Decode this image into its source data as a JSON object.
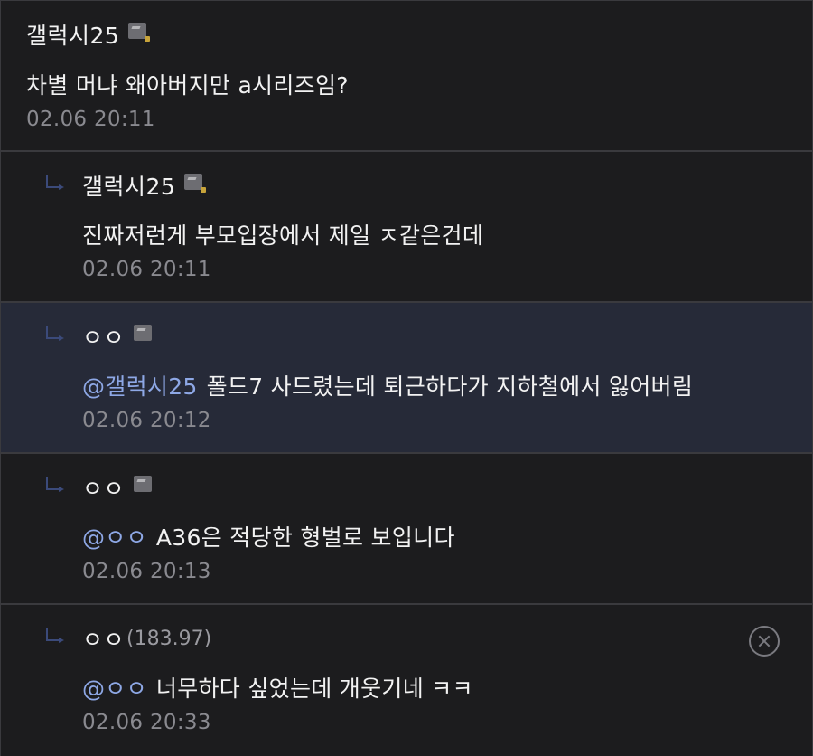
{
  "comments": [
    {
      "author": "갤럭시25",
      "ip": "",
      "mention": "",
      "text": "차별 머냐 왜아버지만 a시리즈임?",
      "time": "02.06 20:11"
    },
    {
      "author": "갤럭시25",
      "ip": "",
      "mention": "",
      "text": "진짜저런게 부모입장에서 제일 ㅈ같은건데",
      "time": "02.06 20:11"
    },
    {
      "author": "ㅇㅇ",
      "ip": "",
      "mention": "@갤럭시25",
      "text": "폴드7 사드렸는데 퇴근하다가 지하철에서 잃어버림",
      "time": "02.06 20:12"
    },
    {
      "author": "ㅇㅇ",
      "ip": "",
      "mention": "@ㅇㅇ",
      "text": "A36은 적당한 형벌로 보입니다",
      "time": "02.06 20:13"
    },
    {
      "author": "ㅇㅇ",
      "ip": "(183.97)",
      "mention": "@ㅇㅇ",
      "text": "너무하다 싶었는데 개웃기네 ㅋㅋ",
      "time": "02.06 20:33"
    }
  ],
  "icons": {
    "badge": "gallery-badge-icon",
    "reply": "reply-arrow-icon",
    "delete": "delete-icon"
  },
  "colors": {
    "background": "#1c1c1e",
    "highlight_row": "#262a38",
    "mention": "#8ea8e6",
    "timestamp": "#8a8a90"
  }
}
